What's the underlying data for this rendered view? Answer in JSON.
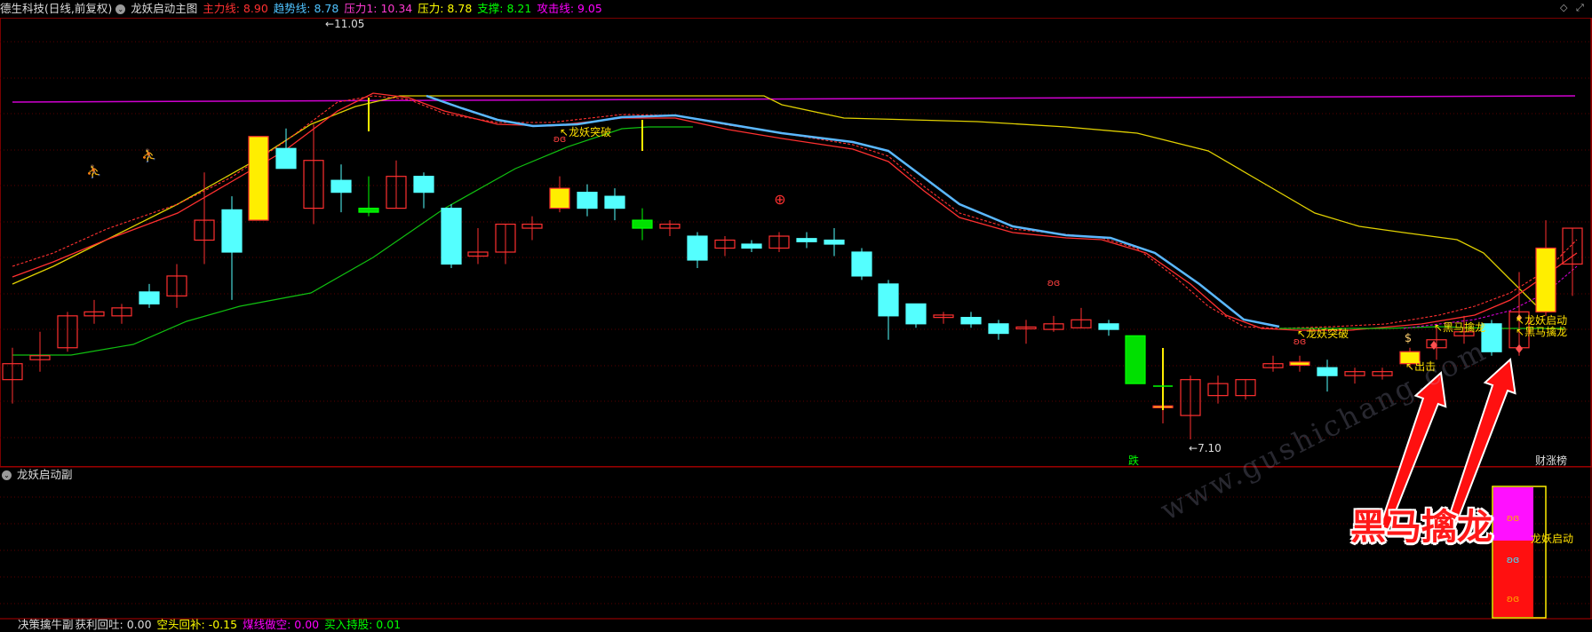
{
  "main_panel": {
    "stock_title": "德生科技(日线,前复权)",
    "indicator_name": "龙妖启动主图",
    "readouts": [
      {
        "label": "主力线:",
        "value": "8.90",
        "color": "#ff3030"
      },
      {
        "label": "趋势线:",
        "value": "8.78",
        "color": "#4fc3ff"
      },
      {
        "label": "压力1:",
        "value": "10.34",
        "color": "#ff3ad0"
      },
      {
        "label": "压力:",
        "value": "8.78",
        "color": "#ffff00"
      },
      {
        "label": "支撑:",
        "value": "8.21",
        "color": "#00ff00"
      },
      {
        "label": "攻击线:",
        "value": "9.05",
        "color": "#ff00ff"
      }
    ],
    "high_marker": "11.05",
    "low_marker": "7.10",
    "signals": {
      "breakout_1": "龙妖突破",
      "breakout_2": "龙妖突破",
      "dark_horse_1": "黑马擒龙",
      "dark_horse_2": "黑马擒龙",
      "launch": "龙妖启动",
      "attack": "出击",
      "drop": "跌",
      "fortune": "财涨榜"
    }
  },
  "sub_panel": {
    "indicator_name": "龙妖启动副",
    "launch_label": "龙妖启动"
  },
  "bottom_panel": {
    "indicator_name": "决策擒牛副",
    "readouts": [
      {
        "label": "获利回吐:",
        "value": "0.00",
        "color": "#dddddd"
      },
      {
        "label": "空头回补:",
        "value": "-0.15",
        "color": "#ffff00"
      },
      {
        "label": "煤线做空:",
        "value": "0.00",
        "color": "#ff00ff"
      },
      {
        "label": "买入持股:",
        "value": "0.01",
        "color": "#00ff00"
      }
    ]
  },
  "overlay": {
    "headline": "黑马擒龙",
    "watermark": "www.gushichang.com"
  },
  "colors": {
    "up": "#ff3030",
    "down": "#54ffff",
    "grid": "#5a0000",
    "ma_yellow": "#e0d000",
    "ma_green": "#10c010",
    "trend_blue": "#5bb8ff",
    "magenta": "#d000d0"
  }
}
